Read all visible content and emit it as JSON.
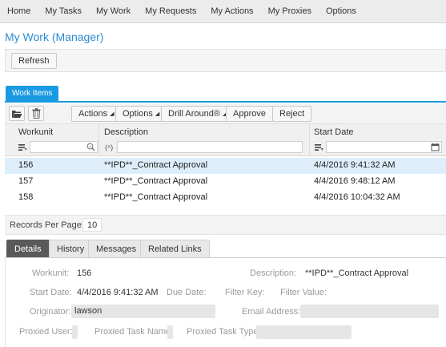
{
  "nav": [
    "Home",
    "My Tasks",
    "My Work",
    "My Requests",
    "My Actions",
    "My Proxies",
    "Options"
  ],
  "page_title": "My Work (Manager)",
  "refresh_label": "Refresh",
  "work_items_tab": "Work Items",
  "toolbar": {
    "actions": "Actions",
    "options": "Options",
    "drill": "Drill Around®",
    "approve": "Approve",
    "reject": "Reject"
  },
  "columns": {
    "workunit": "Workunit",
    "description": "Description",
    "start_date": "Start Date"
  },
  "filters": {
    "workunit": "",
    "description": "",
    "start_date": ""
  },
  "rows": [
    {
      "workunit": "156",
      "description": "**IPD**_Contract Approval",
      "start_date": "4/4/2016 9:41:32 AM",
      "selected": true
    },
    {
      "workunit": "157",
      "description": "**IPD**_Contract Approval",
      "start_date": "4/4/2016 9:48:12 AM",
      "selected": false
    },
    {
      "workunit": "158",
      "description": "**IPD**_Contract Approval",
      "start_date": "4/4/2016 10:04:32 AM",
      "selected": false
    }
  ],
  "records_per_page": {
    "label": "Records Per Page:",
    "value": "10"
  },
  "detail_tabs": [
    "Details",
    "History",
    "Messages",
    "Related Links"
  ],
  "details": {
    "workunit_label": "Workunit:",
    "workunit_value": "156",
    "description_label": "Description:",
    "description_value": "**IPD**_Contract Approval",
    "start_date_label": "Start Date:",
    "start_date_value": "4/4/2016 9:41:32 AM",
    "due_date_label": "Due Date:",
    "filter_key_label": "Filter Key:",
    "filter_value_label": "Filter Value:",
    "originator_label": "Originator:",
    "originator_value": "lawson",
    "email_label": "Email Address:",
    "email_value": "",
    "proxied_user_label": "Proxied User:",
    "proxied_user_value": "",
    "proxied_task_name_label": "Proxied Task Name:",
    "proxied_task_name_value": "",
    "proxied_task_type_label": "Proxied Task Type:",
    "proxied_task_type_value": ""
  },
  "colors": {
    "accent": "#1a9ae2",
    "title": "#2f8bd2",
    "selected_row": "#ddeefa",
    "active_tab": "#5a5a5a"
  },
  "icons": [
    "folder-open-icon",
    "trash-icon",
    "sort-icon",
    "search-icon",
    "text-filter-icon",
    "calendar-icon"
  ]
}
